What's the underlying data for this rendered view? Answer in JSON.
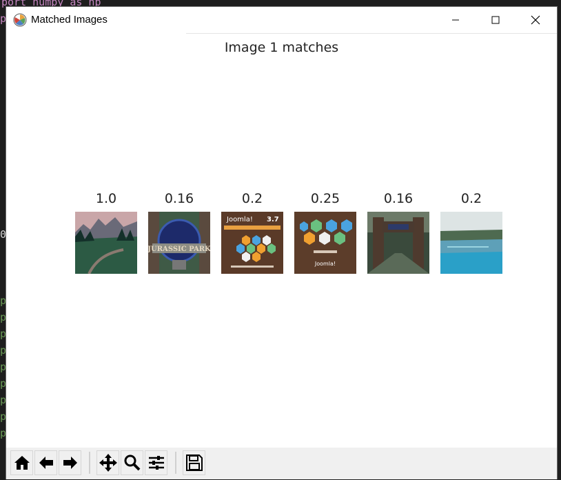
{
  "window": {
    "title": "Matched Images",
    "controls": [
      "minimize",
      "maximize",
      "close"
    ]
  },
  "background_editor": {
    "line1": "port numpy as np",
    "gutter_chars": [
      "p",
      "0",
      "p",
      "p",
      "p",
      "p",
      "p",
      "p",
      "p",
      "p",
      "p"
    ]
  },
  "figure": {
    "title": "Image 1 matches",
    "matches": [
      {
        "score": "1.0",
        "image": "mountain meadow landscape"
      },
      {
        "score": "0.16",
        "image": "Jurassic Park gate logo"
      },
      {
        "score": "0.2",
        "image": "Joomla 3.7 promo graphic"
      },
      {
        "score": "0.25",
        "image": "Joomla features graphic"
      },
      {
        "score": "0.16",
        "image": "Jurassic Park gate photo"
      },
      {
        "score": "0.2",
        "image": "lake with grassy shore"
      }
    ]
  },
  "toolbar": {
    "buttons": [
      "home-icon",
      "back-arrow-icon",
      "forward-arrow-icon",
      "pan-icon",
      "zoom-icon",
      "configure-subplots-icon",
      "save-icon"
    ]
  },
  "thumb_text": {
    "joomla_version": "3.7",
    "joomla_word": "Joomla!",
    "jurassic": "JURASSIC PARK"
  }
}
